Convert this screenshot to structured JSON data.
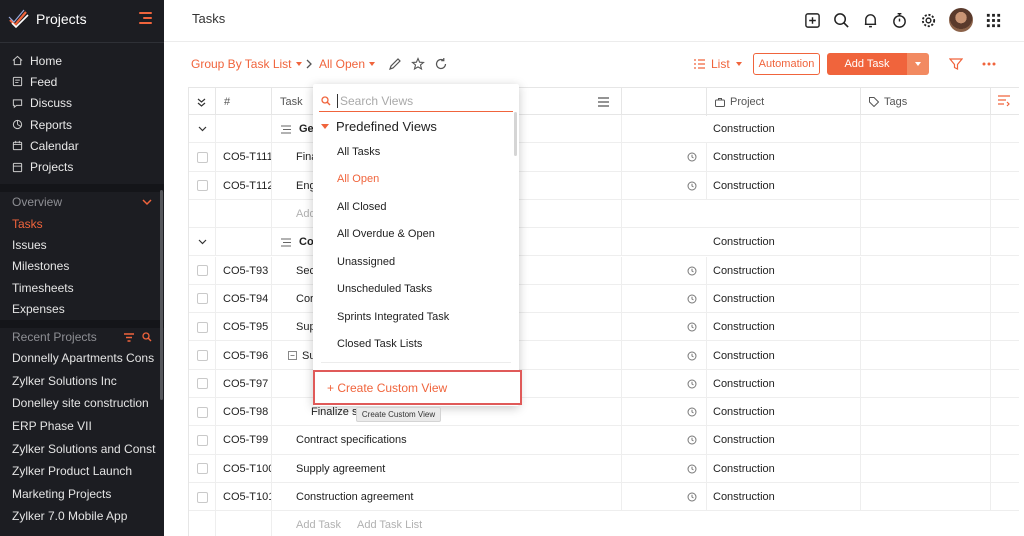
{
  "app": {
    "name": "Projects"
  },
  "sidebar": {
    "nav": [
      {
        "label": "Home",
        "icon": "home-icon"
      },
      {
        "label": "Feed",
        "icon": "feed-icon"
      },
      {
        "label": "Discuss",
        "icon": "discuss-icon"
      },
      {
        "label": "Reports",
        "icon": "reports-icon"
      },
      {
        "label": "Calendar",
        "icon": "calendar-icon"
      },
      {
        "label": "Projects",
        "icon": "projects-icon"
      }
    ],
    "overview_label": "Overview",
    "overview_items": [
      {
        "label": "Tasks",
        "active": true
      },
      {
        "label": "Issues"
      },
      {
        "label": "Milestones"
      },
      {
        "label": "Timesheets"
      },
      {
        "label": "Expenses"
      }
    ],
    "recent_label": "Recent Projects",
    "recent": [
      "Donnelly Apartments Cons",
      "Zylker Solutions Inc",
      "Donelley site construction",
      "ERP Phase VII",
      "Zylker Solutions and Const",
      "Zylker Product Launch",
      "Marketing Projects",
      "Zylker 7.0 Mobile App"
    ]
  },
  "header": {
    "title": "Tasks"
  },
  "toolbar": {
    "group_by": "Group By Task List",
    "view": "All Open",
    "list_toggle": "List",
    "automation": "Automation",
    "add_task": "Add Task"
  },
  "table": {
    "columns": {
      "num": "#",
      "task": "Task",
      "project": "Project",
      "tags": "Tags"
    },
    "rows": [
      {
        "kind": "group",
        "task": "Ger",
        "project": "Construction"
      },
      {
        "kind": "task",
        "id": "CO5-T111",
        "task": "Fina",
        "project": "Construction"
      },
      {
        "kind": "task",
        "id": "CO5-T112",
        "task": "Eng",
        "project": "Construction"
      },
      {
        "kind": "add",
        "task": "Add",
        "project": ""
      },
      {
        "kind": "group",
        "task": "Co",
        "project": "Construction"
      },
      {
        "kind": "task",
        "id": "CO5-T93",
        "task": "Sec",
        "project": "Construction"
      },
      {
        "kind": "task",
        "id": "CO5-T94",
        "task": "Cor",
        "project": "Construction"
      },
      {
        "kind": "task",
        "id": "CO5-T95",
        "task": "Sup",
        "project": "Construction"
      },
      {
        "kind": "task",
        "id": "CO5-T96",
        "task": "Su",
        "project": "Construction",
        "expand": true
      },
      {
        "kind": "task",
        "id": "CO5-T97",
        "task": "",
        "project": "Construction"
      },
      {
        "kind": "task",
        "id": "CO5-T98",
        "task": "Finalize s",
        "project": "Construction",
        "indent": true
      },
      {
        "kind": "task",
        "id": "CO5-T99",
        "task": "Contract specifications",
        "project": "Construction"
      },
      {
        "kind": "task",
        "id": "CO5-T100",
        "task": "Supply agreement",
        "project": "Construction"
      },
      {
        "kind": "task",
        "id": "CO5-T101",
        "task": "Construction agreement",
        "project": "Construction"
      }
    ],
    "footer": {
      "add_task": "Add Task",
      "add_list": "Add Task List"
    }
  },
  "dropdown": {
    "search_placeholder": "Search Views",
    "section": "Predefined Views",
    "items": [
      {
        "label": "All Tasks"
      },
      {
        "label": "All Open",
        "selected": true
      },
      {
        "label": "All Closed"
      },
      {
        "label": "All Overdue & Open"
      },
      {
        "label": "Unassigned"
      },
      {
        "label": "Unscheduled Tasks"
      },
      {
        "label": "Sprints Integrated Task"
      },
      {
        "label": "Closed Task Lists"
      }
    ],
    "create": "+ Create Custom View",
    "tooltip": "Create Custom View"
  },
  "colors": {
    "accent": "#f0643c",
    "sidebar": "#1c1d22",
    "highlight": "#e05a59"
  }
}
